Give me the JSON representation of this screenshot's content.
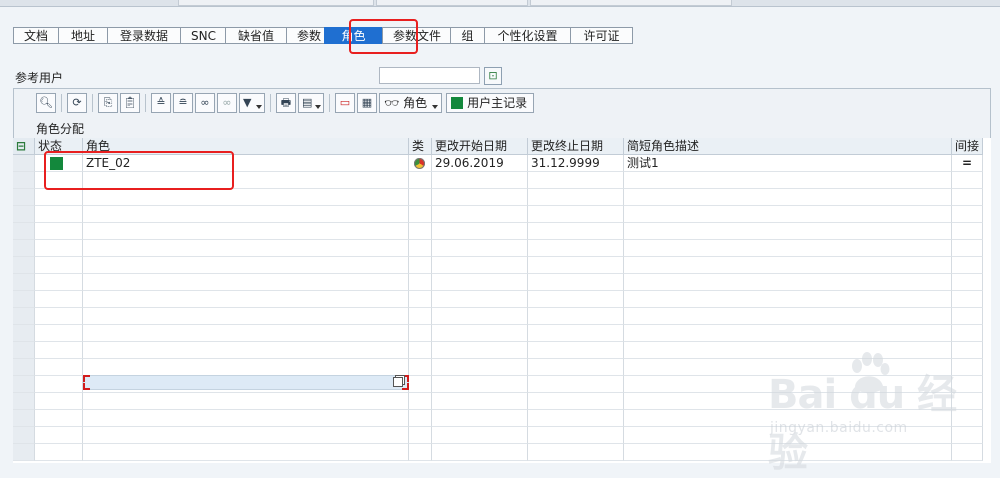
{
  "tabs": [
    {
      "label": "文档",
      "active": false
    },
    {
      "label": "地址",
      "active": false
    },
    {
      "label": "登录数据",
      "active": false
    },
    {
      "label": "SNC",
      "active": false
    },
    {
      "label": "缺省值",
      "active": false
    },
    {
      "label": "参数",
      "active": false
    },
    {
      "label": "角色",
      "active": true
    },
    {
      "label": "参数文件",
      "active": false
    },
    {
      "label": "组",
      "active": false
    },
    {
      "label": "个性化设置",
      "active": false
    },
    {
      "label": "许可证",
      "active": false
    }
  ],
  "reference_user": {
    "label": "参考用户",
    "value": ""
  },
  "toolbar": {
    "role_label": "角色",
    "user_master_label": "用户主记录"
  },
  "grid": {
    "title": "角色分配",
    "columns": [
      "状态",
      "角色",
      "类",
      "更改开始日期",
      "更改终止日期",
      "简短角色描述",
      "间接"
    ],
    "rows": [
      {
        "status": "green",
        "role": "ZTE_02",
        "type": "composite",
        "from": "29.06.2019",
        "to": "31.12.9999",
        "desc": "测试1",
        "indirect": "="
      }
    ]
  },
  "watermark": {
    "logo": "Bai  du 经验",
    "sub": "jingyan.baidu.com"
  },
  "colors": {
    "active_tab": "#1f6fd1",
    "status_green": "#13883c",
    "highlight": "#e81f1f"
  }
}
